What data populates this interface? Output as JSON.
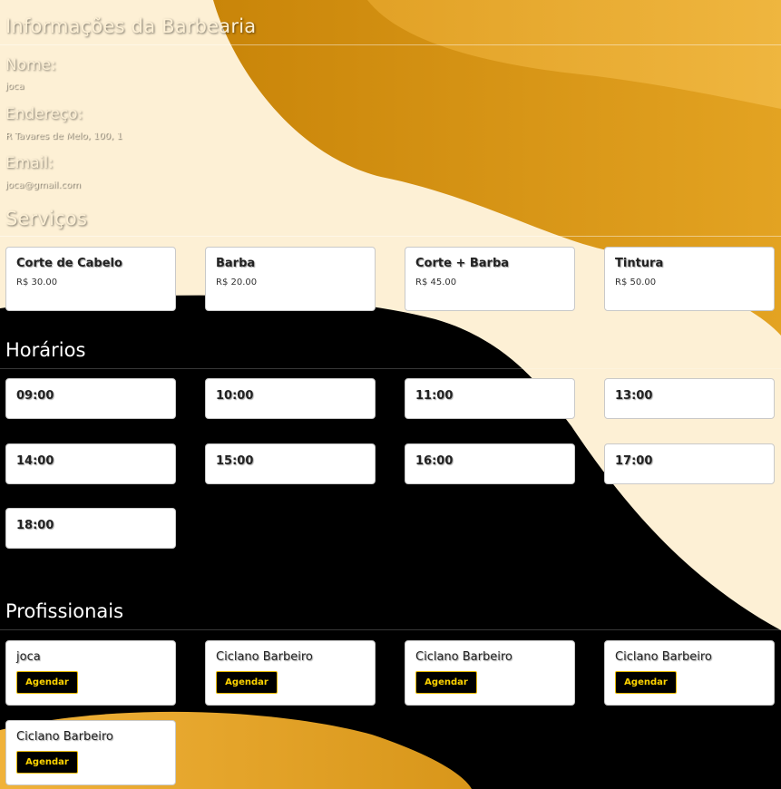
{
  "info": {
    "heading": "Informações da Barbearia",
    "name_label": "Nome:",
    "name_value": "joca",
    "address_label": "Endereço:",
    "address_value": "R Tavares de Melo, 100, 1",
    "email_label": "Email:",
    "email_value": "joca@gmail.com"
  },
  "services": {
    "heading": "Serviços",
    "items": [
      {
        "name": "Corte de Cabelo",
        "price": "R$ 30.00"
      },
      {
        "name": "Barba",
        "price": "R$ 20.00"
      },
      {
        "name": "Corte + Barba",
        "price": "R$ 45.00"
      },
      {
        "name": "Tintura",
        "price": "R$ 50.00"
      }
    ]
  },
  "schedule": {
    "heading": "Horários",
    "slots": [
      "09:00",
      "10:00",
      "11:00",
      "13:00",
      "14:00",
      "15:00",
      "16:00",
      "17:00",
      "18:00"
    ]
  },
  "professionals": {
    "heading": "Profissionais",
    "button_label": "Agendar",
    "items": [
      {
        "name": "joca"
      },
      {
        "name": "Ciclano Barbeiro"
      },
      {
        "name": "Ciclano Barbeiro"
      },
      {
        "name": "Ciclano Barbeiro"
      },
      {
        "name": "Ciclano Barbeiro"
      }
    ]
  },
  "colors": {
    "cream": "#fdf0d5",
    "gold": "#d4920f",
    "black": "#000000",
    "button_text": "#ffd400"
  }
}
